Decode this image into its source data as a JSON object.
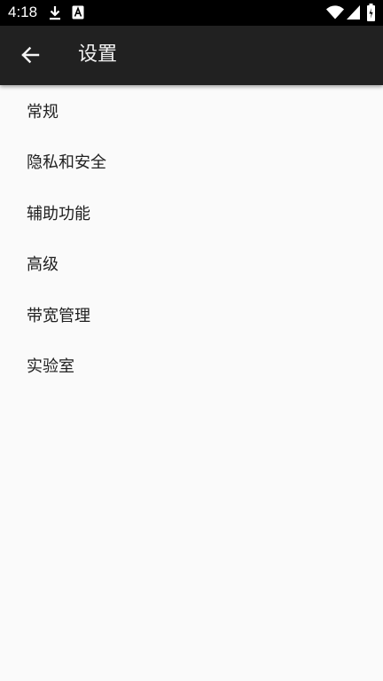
{
  "status_bar": {
    "time": "4:18",
    "left_icons": [
      "download-icon",
      "text-app-icon"
    ],
    "right_icons": [
      "wifi-icon",
      "cellular-signal-icon",
      "battery-icon"
    ]
  },
  "toolbar": {
    "back_icon": "back-arrow-icon",
    "title": "设置",
    "background": "#212121"
  },
  "settings": {
    "items": [
      {
        "label": "常规"
      },
      {
        "label": "隐私和安全"
      },
      {
        "label": "辅助功能"
      },
      {
        "label": "高级"
      },
      {
        "label": "带宽管理"
      },
      {
        "label": "实验室"
      }
    ]
  },
  "colors": {
    "page_background": "#fafafa",
    "text_primary": "#202020",
    "status_bar": "#000000"
  }
}
